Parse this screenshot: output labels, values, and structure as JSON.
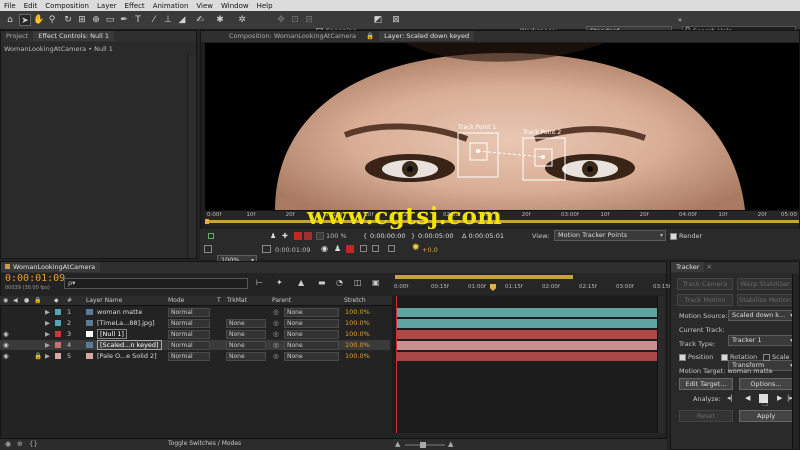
{
  "menu": [
    "File",
    "Edit",
    "Composition",
    "Layer",
    "Effect",
    "Animation",
    "View",
    "Window",
    "Help"
  ],
  "toolbar": {
    "snapping_label": "Snapping",
    "workspace_label": "Workspace:",
    "workspace_value": "Standard",
    "search_placeholder": "Search Help"
  },
  "left_panel": {
    "tabs": [
      "Project",
      "Effect Controls: Null 1"
    ],
    "subtitle": "WomanLookingAtCamera • Null 1"
  },
  "viewer": {
    "tabs": [
      "Composition: WomanLookingAtCamera",
      "Layer: Scaled down keyed"
    ],
    "track_point_1": "Track Point 1",
    "track_point_2": "Track Point 2",
    "watermark": "www.cgtsj.com",
    "ruler_ticks": [
      "0:00f",
      "10f",
      "20f",
      "01:00f",
      "10f",
      "20f",
      "02:00f",
      "10f",
      "20f",
      "03:00f",
      "10f",
      "20f",
      "04:00f",
      "10f",
      "20f",
      "05:00"
    ],
    "zoom": "100%",
    "current_time": "0:00:01:09",
    "in_time": "0:00:00:00",
    "out_time": "0:00:05:00",
    "duration": "Δ 0:00:05:01",
    "view_label": "View:",
    "view_value": "Motion Tracker Points",
    "render_label": "Render",
    "exposure": "+0.0"
  },
  "timeline": {
    "tab": "WomanLookingAtCamera",
    "timecode": "0:00:01:09",
    "timecode_sub": "00039 (30.00 fps)",
    "search_placeholder": "ρ▾",
    "columns": {
      "layer_name": "Layer Name",
      "mode": "Mode",
      "t": "T",
      "trkmat": "TrkMat",
      "parent": "Parent",
      "stretch": "Stretch"
    },
    "ruler": [
      "0:00f",
      "00:15f",
      "01:00f",
      "01:15f",
      "02:00f",
      "02:15f",
      "03:00f",
      "03:15f"
    ],
    "layers": [
      {
        "num": "1",
        "name": "woman matte",
        "mode": "Normal",
        "trkmat": "",
        "parent": "None",
        "stretch": "100.0%",
        "label_color": "#5aa0b8",
        "bar_color": "#5fa3a3"
      },
      {
        "num": "2",
        "name": "[TimeLa...88].jpg]",
        "mode": "Normal",
        "trkmat": "None",
        "parent": "None",
        "stretch": "100.0%",
        "label_color": "#5aa0b8",
        "bar_color": "#5fa3a3"
      },
      {
        "num": "3",
        "name": "[Null 1]",
        "mode": "Normal",
        "trkmat": "None",
        "parent": "None",
        "stretch": "100.0%",
        "label_color": "#c83a3a",
        "bar_color": "#b04747"
      },
      {
        "num": "4",
        "name": "[Scaled...n keyed]",
        "mode": "Normal",
        "trkmat": "None",
        "parent": "None",
        "stretch": "100.0%",
        "label_color": "#c87070",
        "bar_color": "#c89090"
      },
      {
        "num": "5",
        "name": "[Pale O...e Solid 2]",
        "mode": "Normal",
        "trkmat": "None",
        "parent": "None",
        "stretch": "100.0%",
        "label_color": "#d8a8a0",
        "bar_color": "#a84848"
      }
    ],
    "toggle_label": "Toggle Switches / Modes"
  },
  "tracker": {
    "tab": "Tracker",
    "track_camera": "Track Camera",
    "warp_stabilizer": "Warp Stabilizer",
    "track_motion": "Track Motion",
    "stabilize_motion": "Stabilize Motion",
    "motion_source_label": "Motion Source:",
    "motion_source_value": "Scaled down k...",
    "current_track_label": "Current Track:",
    "current_track_value": "Tracker 1",
    "track_type_label": "Track Type:",
    "track_type_value": "Transform",
    "position_label": "Position",
    "rotation_label": "Rotation",
    "scale_label": "Scale",
    "motion_target": "Motion Target: woman matte",
    "edit_target": "Edit Target...",
    "options": "Options...",
    "analyze_label": "Analyze:",
    "reset": "Reset",
    "apply": "Apply"
  }
}
